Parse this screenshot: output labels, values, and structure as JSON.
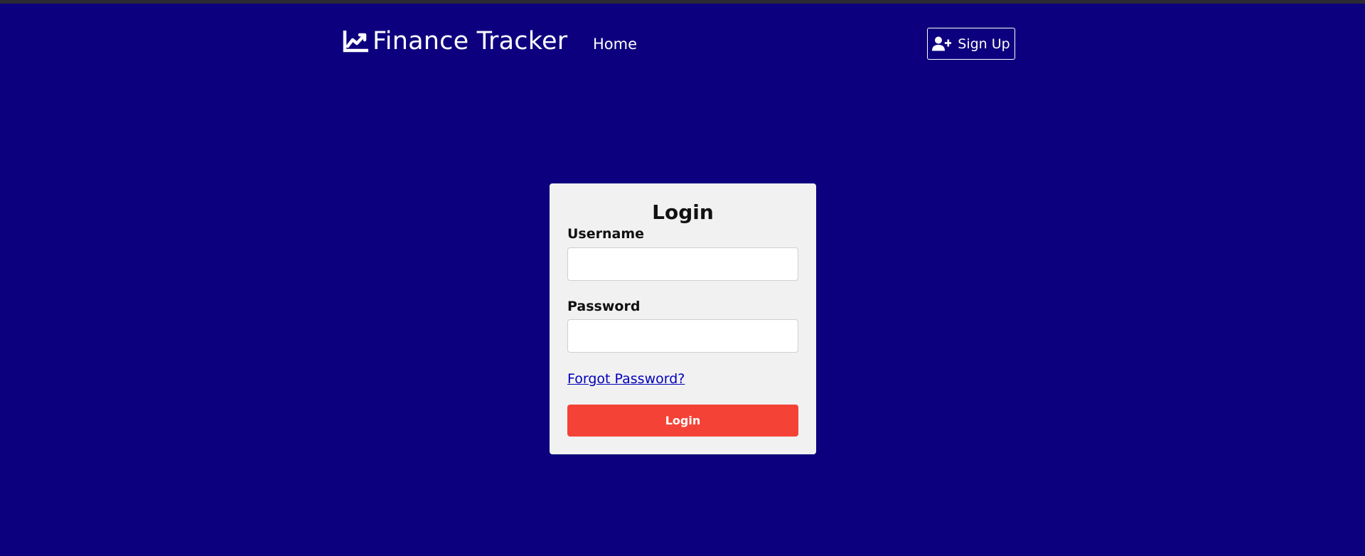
{
  "colors": {
    "background": "#0d007e",
    "card": "#f1f1f1",
    "login_button": "#f44336",
    "link": "#0000b8",
    "text_light": "#ffffff"
  },
  "navbar": {
    "brand_icon": "chart-line-icon",
    "brand_name": "Finance Tracker",
    "home_label": "Home",
    "signup_icon": "user-plus-icon",
    "signup_label": "Sign Up"
  },
  "login_form": {
    "title": "Login",
    "username_label": "Username",
    "username_value": "",
    "password_label": "Password",
    "password_value": "",
    "forgot_password_label": "Forgot Password?",
    "submit_label": "Login"
  }
}
